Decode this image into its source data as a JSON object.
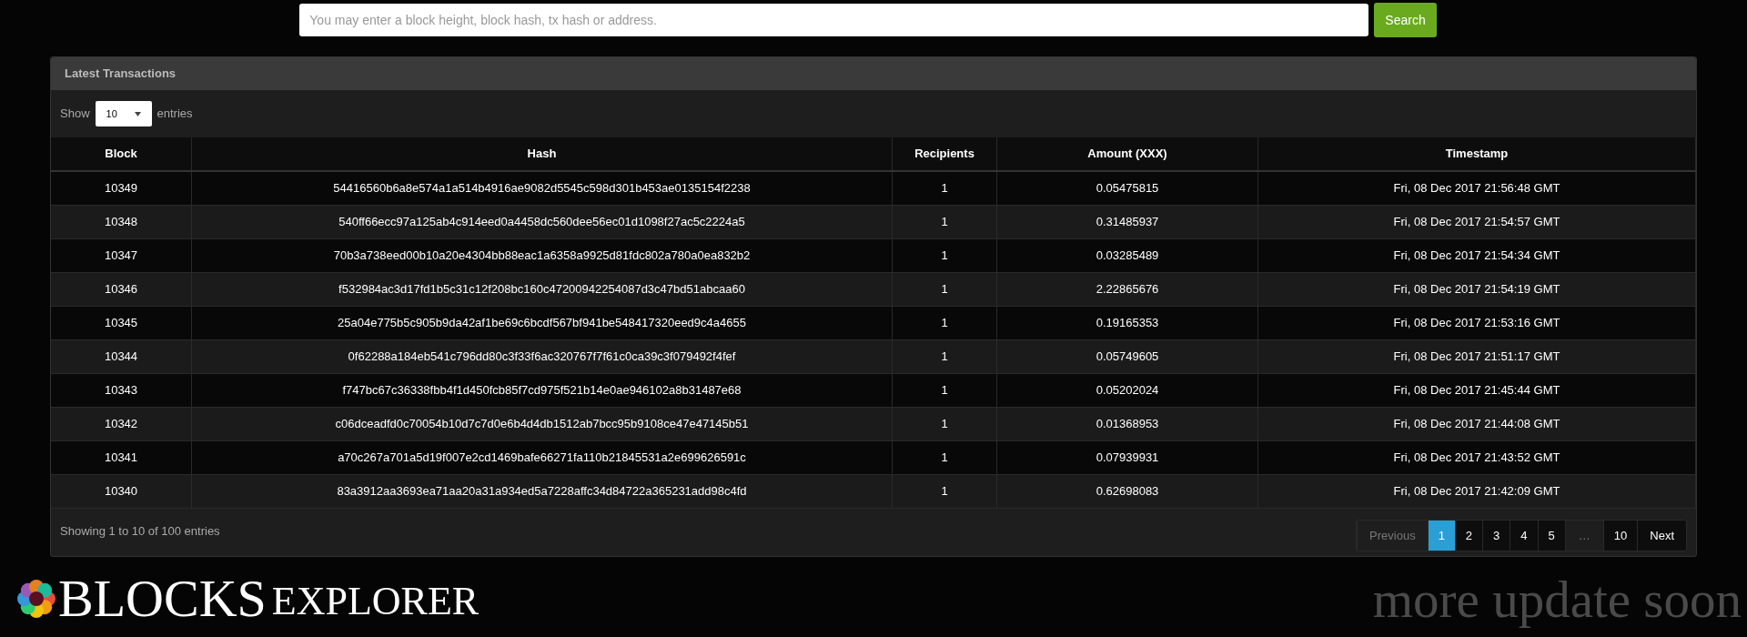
{
  "search": {
    "placeholder": "You may enter a block height, block hash, tx hash or address.",
    "button": "Search"
  },
  "panel": {
    "title": "Latest Transactions",
    "length_prefix": "Show",
    "length_value": "10",
    "length_suffix": "entries"
  },
  "table": {
    "columns": [
      "Block",
      "Hash",
      "Recipients",
      "Amount (XXX)",
      "Timestamp"
    ],
    "rows": [
      [
        "10349",
        "54416560b6a8e574a1a514b4916ae9082d5545c598d301b453ae0135154f2238",
        "1",
        "0.05475815",
        "Fri, 08 Dec 2017 21:56:48 GMT"
      ],
      [
        "10348",
        "540ff66ecc97a125ab4c914eed0a4458dc560dee56ec01d1098f27ac5c2224a5",
        "1",
        "0.31485937",
        "Fri, 08 Dec 2017 21:54:57 GMT"
      ],
      [
        "10347",
        "70b3a738eed00b10a20e4304bb88eac1a6358a9925d81fdc802a780a0ea832b2",
        "1",
        "0.03285489",
        "Fri, 08 Dec 2017 21:54:34 GMT"
      ],
      [
        "10346",
        "f532984ac3d17fd1b5c31c12f208bc160c47200942254087d3c47bd51abcaa60",
        "1",
        "2.22865676",
        "Fri, 08 Dec 2017 21:54:19 GMT"
      ],
      [
        "10345",
        "25a04e775b5c905b9da42af1be69c6bcdf567bf941be548417320eed9c4a4655",
        "1",
        "0.19165353",
        "Fri, 08 Dec 2017 21:53:16 GMT"
      ],
      [
        "10344",
        "0f62288a184eb541c796dd80c3f33f6ac320767f7f61c0ca39c3f079492f4fef",
        "1",
        "0.05749605",
        "Fri, 08 Dec 2017 21:51:17 GMT"
      ],
      [
        "10343",
        "f747bc67c36338fbb4f1d450fcb85f7cd975f521b14e0ae946102a8b31487e68",
        "1",
        "0.05202024",
        "Fri, 08 Dec 2017 21:45:44 GMT"
      ],
      [
        "10342",
        "c06dceadfd0c70054b10d7c7d0e6b4d4db1512ab7bcc95b9108ce47e47145b51",
        "1",
        "0.01368953",
        "Fri, 08 Dec 2017 21:44:08 GMT"
      ],
      [
        "10341",
        "a70c267a701a5d19f007e2cd1469bafe66271fa110b21845531a2e699626591c",
        "1",
        "0.07939931",
        "Fri, 08 Dec 2017 21:43:52 GMT"
      ],
      [
        "10340",
        "83a3912aa3693ea71aa20a31a934ed5a7228affc34d84722a365231add98c4fd",
        "1",
        "0.62698083",
        "Fri, 08 Dec 2017 21:42:09 GMT"
      ]
    ]
  },
  "info": "Showing 1 to 10 of 100 entries",
  "pagination": [
    {
      "kind": "prev",
      "label": "Previous",
      "selected": false,
      "disabled": true
    },
    {
      "kind": "page",
      "label": "1",
      "selected": true,
      "disabled": false
    },
    {
      "kind": "page",
      "label": "2",
      "selected": false,
      "disabled": false
    },
    {
      "kind": "page",
      "label": "3",
      "selected": false,
      "disabled": false
    },
    {
      "kind": "page",
      "label": "4",
      "selected": false,
      "disabled": false
    },
    {
      "kind": "page",
      "label": "5",
      "selected": false,
      "disabled": false
    },
    {
      "kind": "ellipsis",
      "label": "…",
      "selected": false,
      "disabled": true
    },
    {
      "kind": "page",
      "label": "10",
      "selected": false,
      "disabled": false
    },
    {
      "kind": "next",
      "label": "Next",
      "selected": false,
      "disabled": false
    }
  ],
  "footer": {
    "logo_bold": "BLOCKS",
    "logo_light": "EXPLORER",
    "note": "more update soon"
  }
}
